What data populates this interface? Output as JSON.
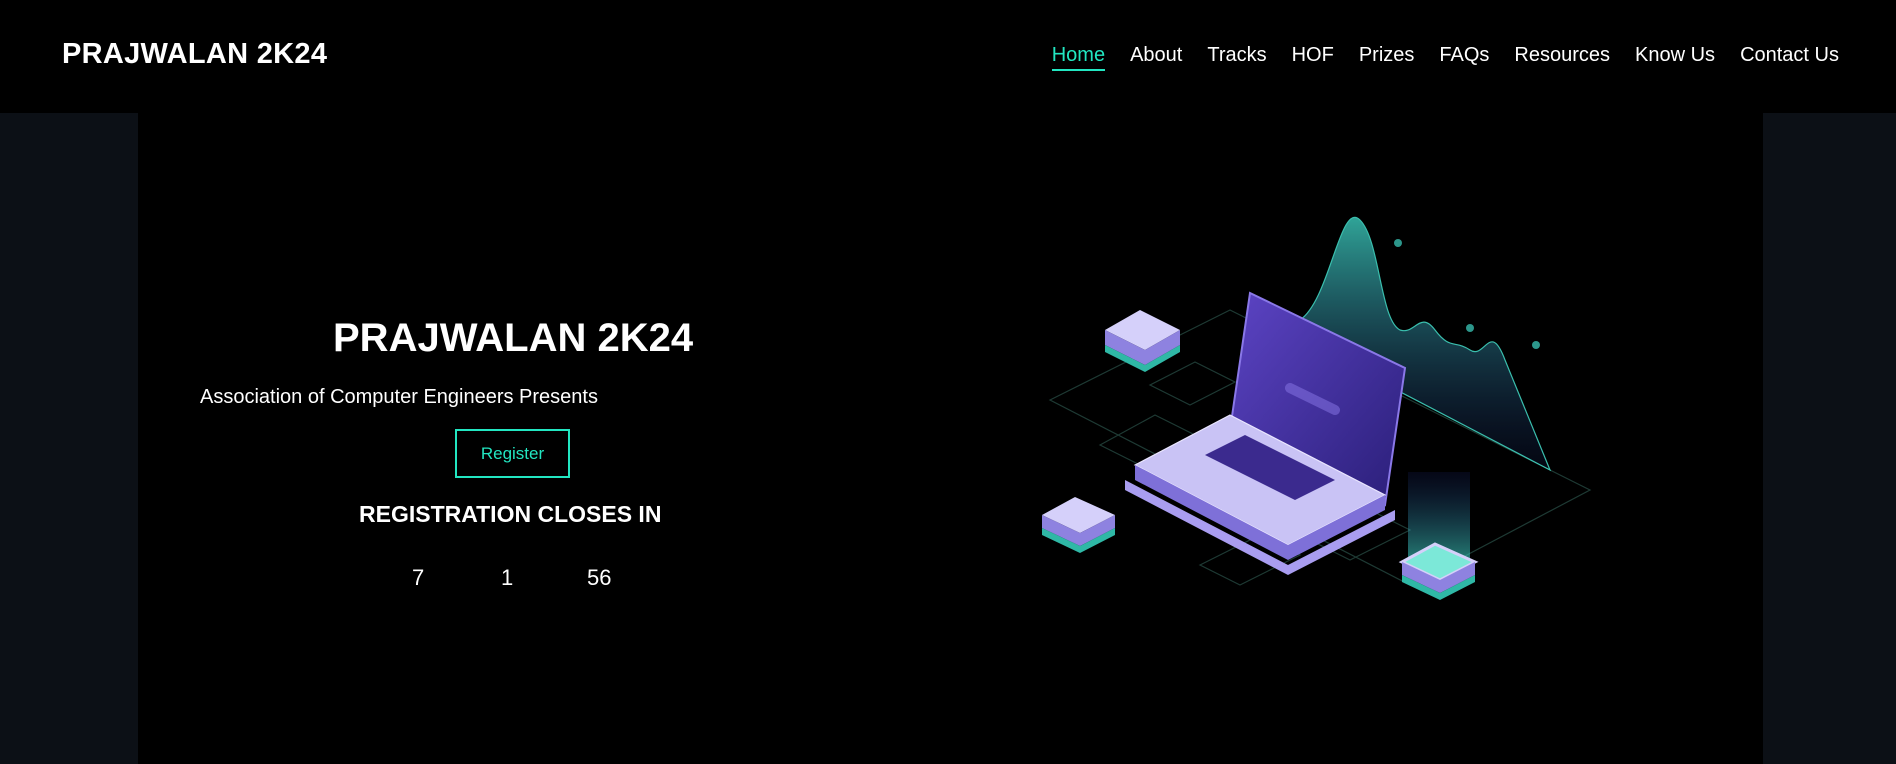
{
  "navbar": {
    "brand": "PRAJWALAN 2K24",
    "links": [
      {
        "label": "Home",
        "active": true
      },
      {
        "label": "About"
      },
      {
        "label": "Tracks"
      },
      {
        "label": "HOF"
      },
      {
        "label": "Prizes"
      },
      {
        "label": "FAQs"
      },
      {
        "label": "Resources"
      },
      {
        "label": "Know Us"
      },
      {
        "label": "Contact Us"
      }
    ]
  },
  "hero": {
    "title": "PRAJWALAN 2K24",
    "subtitle": "Association of Computer Engineers Presents",
    "register_label": "Register",
    "closes_label": "REGISTRATION CLOSES IN",
    "countdown": [
      "7",
      "1",
      "56"
    ]
  },
  "colors": {
    "accent": "#22e6c1",
    "background": "#000000",
    "side_panel": "#0c1016",
    "illustration_purple": "#4b36a8",
    "illustration_lavender": "#c9c3f5"
  },
  "icons": {
    "illustration": "isometric-laptop-analytics-illustration"
  }
}
